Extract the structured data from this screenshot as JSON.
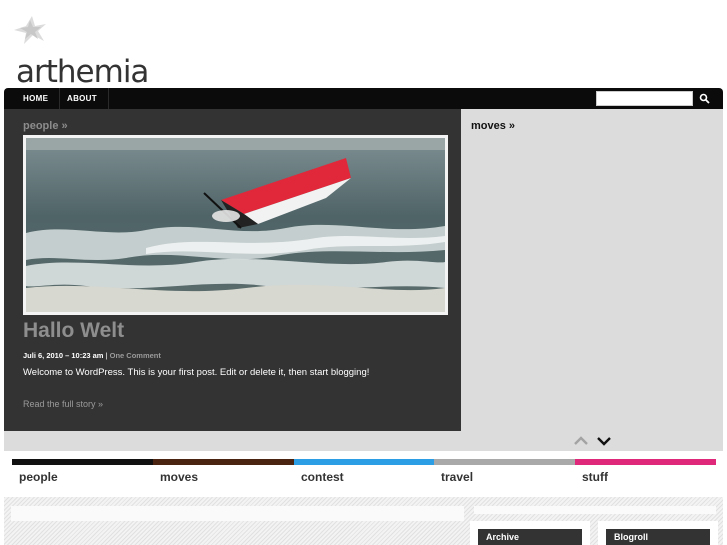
{
  "site": {
    "logo_text": "arthemia"
  },
  "nav": {
    "items": [
      {
        "label": "HOME"
      },
      {
        "label": "ABOUT"
      }
    ],
    "search": {
      "value": "",
      "placeholder": ""
    }
  },
  "featured": {
    "category_label": "people »",
    "post": {
      "title": "Hallo Welt",
      "date": "Juli 6, 2010 – 10:23 am",
      "separator": " | ",
      "comments": "One Comment",
      "excerpt": "Welcome to WordPress. This is your first post. Edit or delete it, then start blogging!",
      "read_more": "Read the full story »"
    },
    "side_label": "moves »"
  },
  "categories": [
    {
      "label": "people",
      "color": "#111111"
    },
    {
      "label": "moves",
      "color": "#4a2410"
    },
    {
      "label": "contest",
      "color": "#2b9ee5"
    },
    {
      "label": "travel",
      "color": "#a9a9a9"
    },
    {
      "label": "stuff",
      "color": "#e0287a"
    }
  ],
  "sidebar": {
    "widgets": [
      {
        "title": "Archive"
      },
      {
        "title": "Blogroll"
      }
    ]
  },
  "icons": {
    "logo": "star-icon",
    "search": "magnifier-icon",
    "prev": "chevron-up-icon",
    "next": "chevron-down-icon"
  }
}
